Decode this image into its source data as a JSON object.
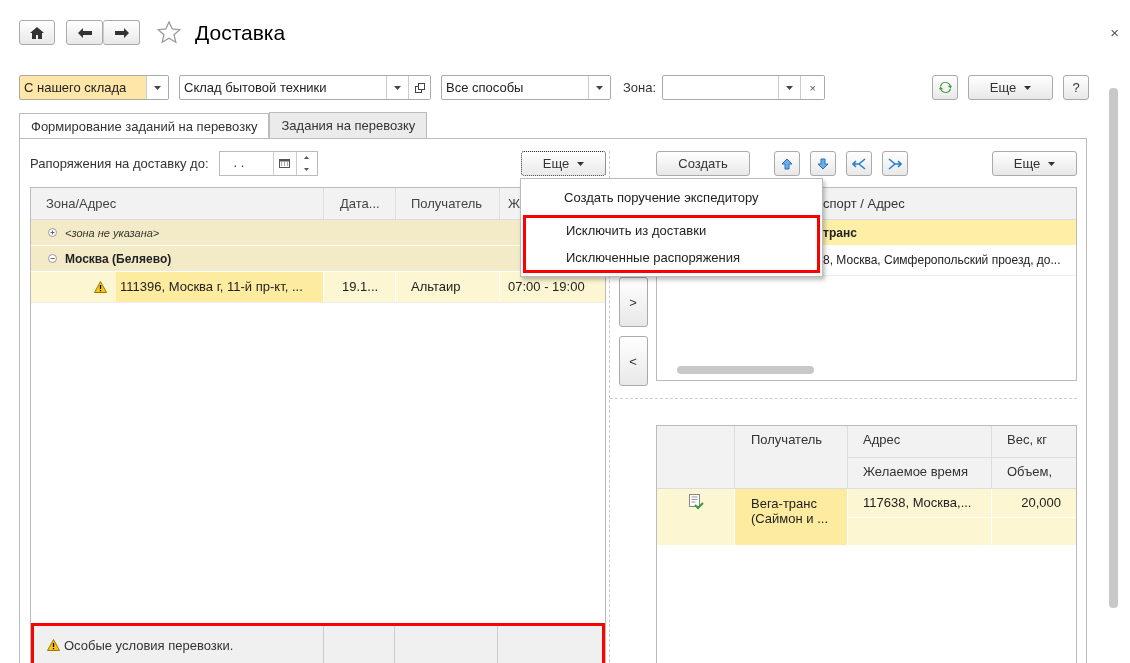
{
  "header": {
    "title": "Доставка",
    "close": "×"
  },
  "filters": {
    "source": "С нашего склада",
    "warehouse": "Склад бытовой техники",
    "method": "Все способы",
    "zone_label": "Зона:",
    "zone_clear": "×",
    "more": "Еще",
    "help": "?"
  },
  "tabs": [
    {
      "label": "Формирование заданий на перевозку",
      "selected": true
    },
    {
      "label": "Задания на перевозку",
      "selected": false
    }
  ],
  "left": {
    "date_label": "Рапоряжения на доставку до:",
    "date_value": ". .",
    "more": "Еще",
    "columns": [
      "Зона/Адрес",
      "Дата...",
      "Получатель",
      "Ж"
    ],
    "rows": [
      {
        "kind": "placeholder_group",
        "text": "<зона не указана>",
        "expanded": false
      },
      {
        "kind": "group",
        "text": "Москва (Беляево)",
        "expanded": true
      },
      {
        "kind": "item",
        "warning": true,
        "cells": [
          "111396, Москва г, 11-й пр-кт, ...",
          "19.1...",
          "Альтаир",
          "07:00 - 19:00"
        ]
      }
    ],
    "footer": {
      "text": "Особые условия перевозки.",
      "warning": true,
      "highlighted": true
    }
  },
  "menu": {
    "items": [
      {
        "label": "Создать поручение экспедитору",
        "highlighted": false
      },
      {
        "label": "Исключить из доставки",
        "highlighted": true
      },
      {
        "label": "Исключенные распоряжения",
        "highlighted": true
      }
    ]
  },
  "transfer": {
    "forward": ">",
    "back": "<"
  },
  "right": {
    "create": "Создать",
    "more": "Еще",
    "top_table": {
      "column": "спорт / Адрес",
      "rows": [
        {
          "kind": "group",
          "text": "транс"
        },
        {
          "kind": "item",
          "text": "8, Москва, Симферопольский проезд, до..."
        }
      ]
    },
    "bottom_table": {
      "columns": [
        {
          "top": "Получатель"
        },
        {
          "top": "Адрес",
          "bottom": "Желаемое время"
        },
        {
          "top": "Вес, кг",
          "bottom": "Объем,"
        }
      ],
      "rows": [
        {
          "checked": true,
          "recipient": "Вега-транс (Саймон и ...",
          "address": "117638, Москва,...",
          "weight": "20,000"
        }
      ]
    }
  }
}
